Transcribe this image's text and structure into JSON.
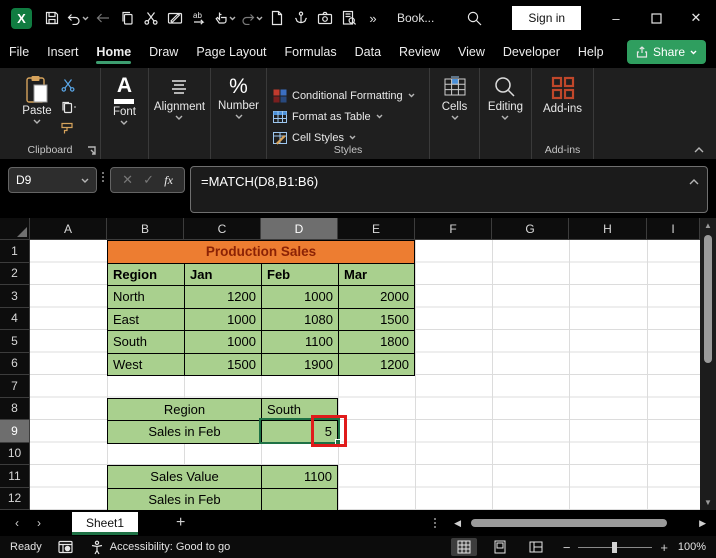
{
  "window": {
    "title": "Book...",
    "sign_in": "Sign in",
    "more_commands": "»"
  },
  "menu": {
    "tabs": [
      "File",
      "Insert",
      "Home",
      "Draw",
      "Page Layout",
      "Formulas",
      "Data",
      "Review",
      "View",
      "Developer",
      "Help"
    ],
    "active_tab": "Home",
    "share": "Share"
  },
  "ribbon": {
    "paste": "Paste",
    "font": "Font",
    "alignment": "Alignment",
    "number": "Number",
    "conditional_formatting": "Conditional Formatting",
    "format_as_table": "Format as Table",
    "cell_styles": "Cell Styles",
    "cells": "Cells",
    "editing": "Editing",
    "addins_button": "Add-ins",
    "groups": {
      "clipboard": "Clipboard",
      "styles": "Styles",
      "addins": "Add-ins"
    }
  },
  "formula_bar": {
    "name_box": "D9",
    "fx": "fx",
    "formula": "=MATCH(D8,B1:B6)"
  },
  "sheet": {
    "columns": [
      "A",
      "B",
      "C",
      "D",
      "E",
      "F",
      "G",
      "H",
      "I"
    ],
    "rows": [
      "1",
      "2",
      "3",
      "4",
      "5",
      "6",
      "7",
      "8",
      "9",
      "10",
      "11",
      "12"
    ],
    "selected_cell": "D9",
    "selected_column": "D",
    "selected_row": "9",
    "title": "Production Sales",
    "main_table": {
      "headers": [
        "Region",
        "Jan",
        "Feb",
        "Mar"
      ],
      "data": [
        [
          "North",
          "1200",
          "1000",
          "2000"
        ],
        [
          "East",
          "1000",
          "1080",
          "1500"
        ],
        [
          "South",
          "1000",
          "1100",
          "1800"
        ],
        [
          "West",
          "1500",
          "1900",
          "1200"
        ]
      ]
    },
    "lookup_table": {
      "data": [
        [
          "Region",
          "South"
        ],
        [
          "Sales in Feb",
          "5"
        ]
      ]
    },
    "result_table": {
      "data": [
        [
          "Sales Value",
          "1100"
        ],
        [
          "Sales in Feb",
          ""
        ]
      ]
    }
  },
  "tab_bar": {
    "sheets": [
      "Sheet1"
    ],
    "active_sheet": "Sheet1"
  },
  "status_bar": {
    "mode": "Ready",
    "accessibility": "Accessibility: Good to go",
    "zoom_level": "100%"
  },
  "colors": {
    "accent_green": "#217346",
    "share_green": "#2f9e5f",
    "header_orange": "#ED7D31",
    "header_title_text": "#8B2205",
    "cell_green": "#A9D08E",
    "annotation_red": "#E01B1B"
  },
  "icons": [
    "excel-logo",
    "save-icon",
    "undo-icon",
    "back-icon",
    "copy-icon",
    "cut-icon",
    "note-pen-icon",
    "replace-icon",
    "touch-mode-icon",
    "redo-icon",
    "new-file-icon",
    "anchor-icon",
    "camera-icon",
    "doc-search-icon",
    "search-icon",
    "paste-icon",
    "format-painter-icon",
    "conditional-formatting-icon",
    "format-as-table-icon",
    "cell-styles-icon",
    "cells-icon",
    "editing-icon",
    "addins-icon",
    "macro-record-icon",
    "accessibility-icon",
    "normal-view-icon",
    "page-layout-icon",
    "page-break-icon"
  ]
}
